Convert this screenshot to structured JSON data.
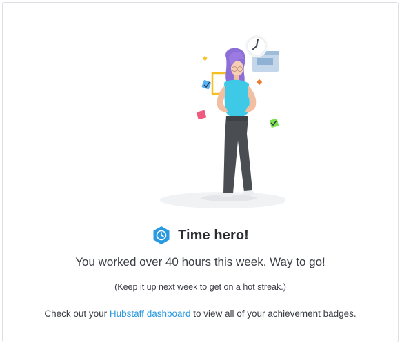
{
  "colors": {
    "accent": "#2a9ae0",
    "badge": "#2a9ae0",
    "text": "#3b3e45",
    "title": "#2b2d33",
    "border": "#dcdfe3"
  },
  "illustration": {
    "icon": "woman-hands-on-hips-illustration",
    "decorations": [
      "clock-icon",
      "calendar-card-icon",
      "checkmark-note-icon",
      "confetti-icon"
    ]
  },
  "badge": {
    "icon": "clock-hexagon-icon"
  },
  "title": "Time hero!",
  "message": "You worked over 40 hours this week. Way to go!",
  "hint": "(Keep it up next week to get on a hot streak.)",
  "cta": {
    "before": "Check out your ",
    "link": "Hubstaff dashboard",
    "after": " to view all of your achievement badges."
  }
}
